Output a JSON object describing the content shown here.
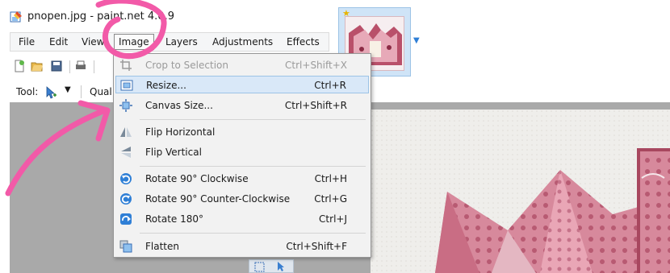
{
  "window": {
    "title": "pnopen.jpg - paint.net 4.0.9"
  },
  "menubar": {
    "items": [
      "File",
      "Edit",
      "View",
      "Image",
      "Layers",
      "Adjustments",
      "Effects"
    ],
    "active": "Image"
  },
  "toolbar": {
    "tool_label": "Tool:",
    "quality_label": "Qual"
  },
  "image_menu": {
    "items": [
      {
        "label": "Crop to Selection",
        "shortcut": "Ctrl+Shift+X",
        "icon": "crop-icon",
        "enabled": false
      },
      {
        "label": "Resize...",
        "shortcut": "Ctrl+R",
        "icon": "resize-icon",
        "enabled": true,
        "highlighted": true
      },
      {
        "label": "Canvas Size...",
        "shortcut": "Ctrl+Shift+R",
        "icon": "canvas-size-icon",
        "enabled": true
      },
      {
        "label": "Flip Horizontal",
        "shortcut": "",
        "icon": "flip-horizontal-icon",
        "enabled": true
      },
      {
        "label": "Flip Vertical",
        "shortcut": "",
        "icon": "flip-vertical-icon",
        "enabled": true
      },
      {
        "label": "Rotate 90° Clockwise",
        "shortcut": "Ctrl+H",
        "icon": "rotate-cw-icon",
        "enabled": true
      },
      {
        "label": "Rotate 90° Counter-Clockwise",
        "shortcut": "Ctrl+G",
        "icon": "rotate-ccw-icon",
        "enabled": true
      },
      {
        "label": "Rotate 180°",
        "shortcut": "Ctrl+J",
        "icon": "rotate-180-icon",
        "enabled": true
      },
      {
        "label": "Flatten",
        "shortcut": "Ctrl+Shift+F",
        "icon": "flatten-icon",
        "enabled": true
      }
    ]
  },
  "colors": {
    "annotation_pink": "#f25aa8",
    "highlight": "#d9e8f8",
    "menu_bg": "#f2f2f2"
  }
}
